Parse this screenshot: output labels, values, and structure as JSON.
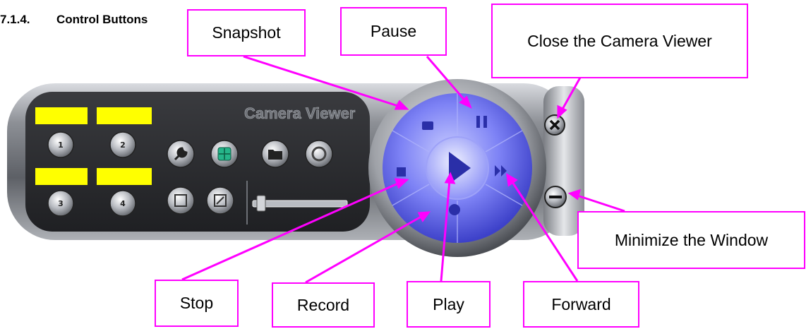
{
  "section": {
    "number": "7.1.4.",
    "title": "Control Buttons"
  },
  "panel": {
    "title": "Camera Viewer",
    "channels": [
      "1",
      "2",
      "3",
      "4"
    ]
  },
  "callouts": {
    "snapshot": "Snapshot",
    "pause": "Pause",
    "close": "Close the Camera Viewer",
    "minimize": "Minimize the Window",
    "stop": "Stop",
    "record": "Record",
    "play": "Play",
    "forward": "Forward"
  },
  "colors": {
    "callout_border": "#ff00ff",
    "channel_label": "#ffff00",
    "dial_blue": "#5a5ef0",
    "panel_dark": "#2a2b2e"
  },
  "icons": [
    "wrench-icon",
    "grid-icon",
    "folder-icon",
    "refresh-icon",
    "settings-icon",
    "edit-icon",
    "camera-icon",
    "pause-icon",
    "stop-icon",
    "play-icon",
    "forward-icon",
    "record-icon",
    "close-icon",
    "minimize-icon"
  ]
}
